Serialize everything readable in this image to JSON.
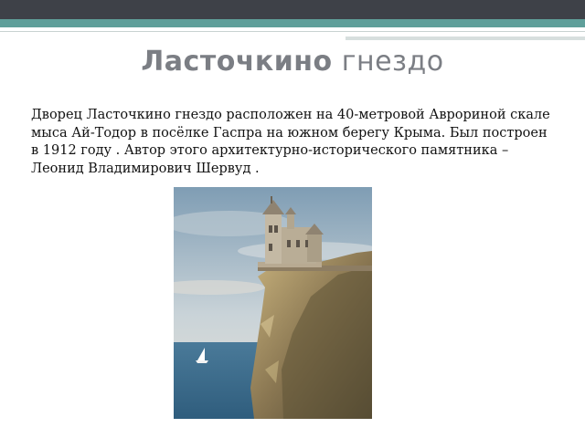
{
  "slide": {
    "title_bold": "Ласточкино",
    "title_light": "гнездо",
    "body": "Дворец Ласточкино гнездо  расположен на 40-метровой Аврориной скале мыса Ай-Тодор в посёлке Гаспра на южном берегу Крыма. Был построен в 1912 году . Автор этого архитектурно-исторического памятника – Леонид Владимирович Шервуд ."
  },
  "colors": {
    "top_bar": "#3e4148",
    "accent_bar": "#5f9f9a",
    "title": "#7b7e84",
    "text": "#111111"
  }
}
